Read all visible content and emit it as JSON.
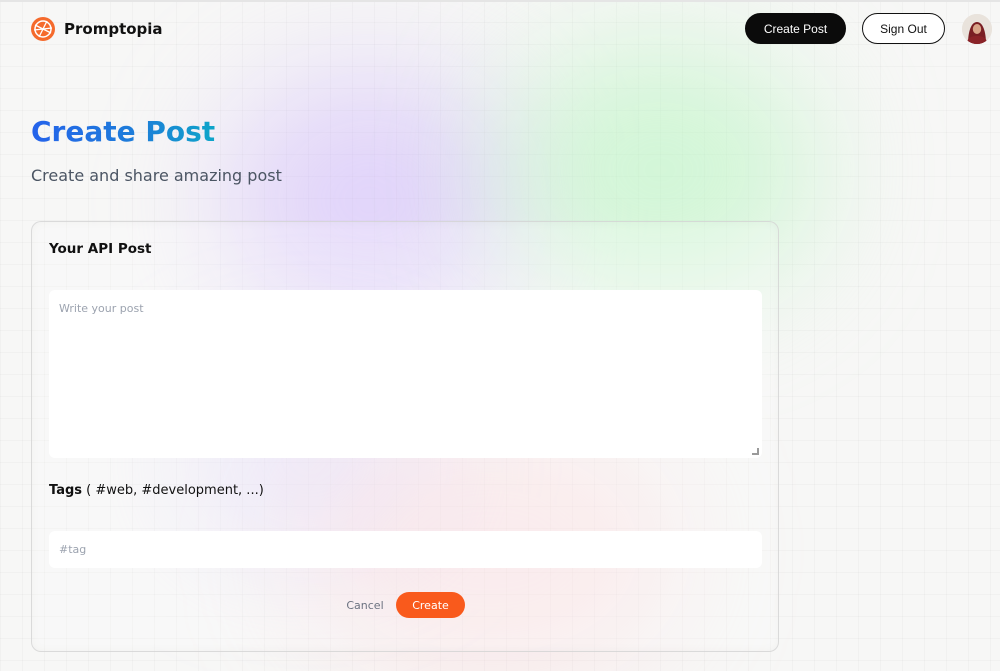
{
  "app": {
    "name": "Promptopia",
    "accent_color": "#f95a1c"
  },
  "nav": {
    "create_post_label": "Create Post",
    "sign_out_label": "Sign Out",
    "avatar_icon": "user-avatar"
  },
  "header": {
    "title": "Create Post",
    "subtitle": "Create and share amazing post"
  },
  "form": {
    "post_label": "Your API Post",
    "post_placeholder": "Write your post",
    "post_value": "",
    "tags_label": "Tags",
    "tags_hint": " ( #web, #development, ...)",
    "tags_placeholder": "#tag",
    "tags_value": "",
    "cancel_label": "Cancel",
    "submit_label": "Create"
  }
}
